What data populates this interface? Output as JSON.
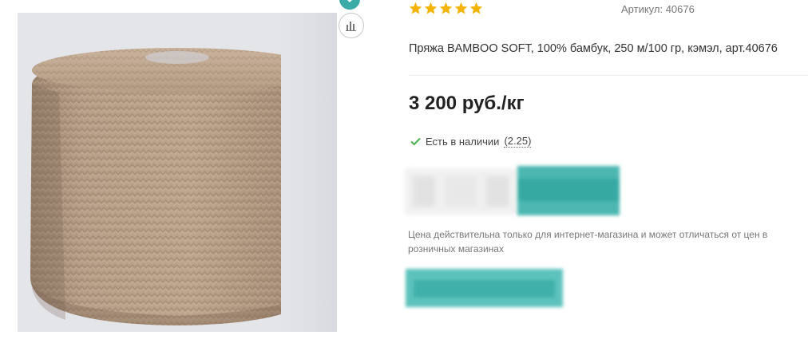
{
  "product": {
    "rating": 5,
    "article_label": "Артикул: 40676",
    "title": "Пряжа BAMBOO SOFT, 100% бамбук, 250 м/100 гр, кэмэл, арт.40676",
    "price": "3 200 руб./кг",
    "stock_text": "Есть в наличии",
    "stock_qty": "(2.25)",
    "price_note": "Цена действительна только для интернет-магазина и может отличаться от цен в розничных магазинах"
  },
  "icons": {
    "compare": "bar-chart-icon",
    "favorite": "heart-icon",
    "stock": "checkmark-icon",
    "rating": "star-icon"
  },
  "colors": {
    "accent": "#3aaba6",
    "star": "#f5b301",
    "stock_check": "#4caf50",
    "yarn": "#b39a82"
  }
}
